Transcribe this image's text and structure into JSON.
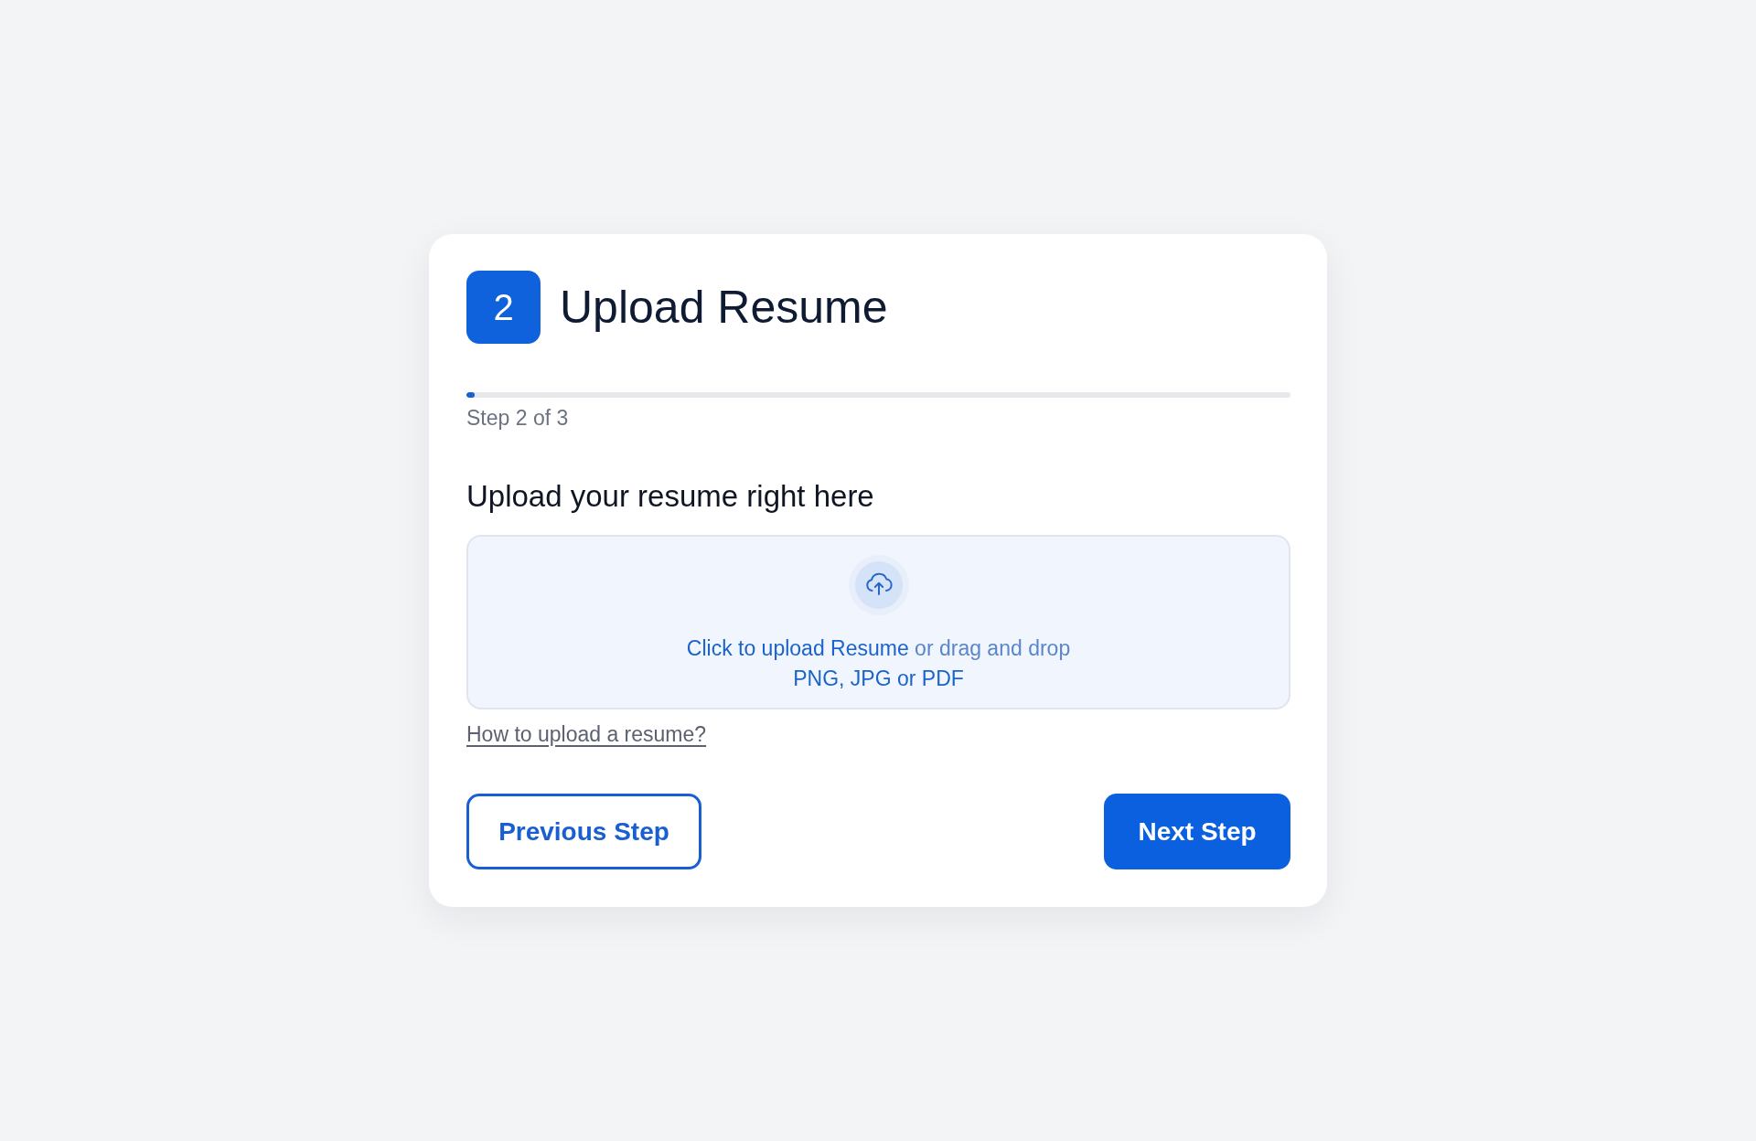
{
  "step_badge": "2",
  "title": "Upload Resume",
  "progress": {
    "level": 0.01,
    "label": "Step 2 of 3"
  },
  "upload": {
    "heading": "Upload your resume right here",
    "link": "Click to upload Resume",
    "prompt": "or drag and drop",
    "formats": "PNG, JPG or PDF"
  },
  "help_link": "How to upload a resume?",
  "buttons": [
    {
      "label": "Previous Step",
      "kind": "secondary"
    },
    {
      "label": "Next Step",
      "kind": "primary"
    }
  ]
}
